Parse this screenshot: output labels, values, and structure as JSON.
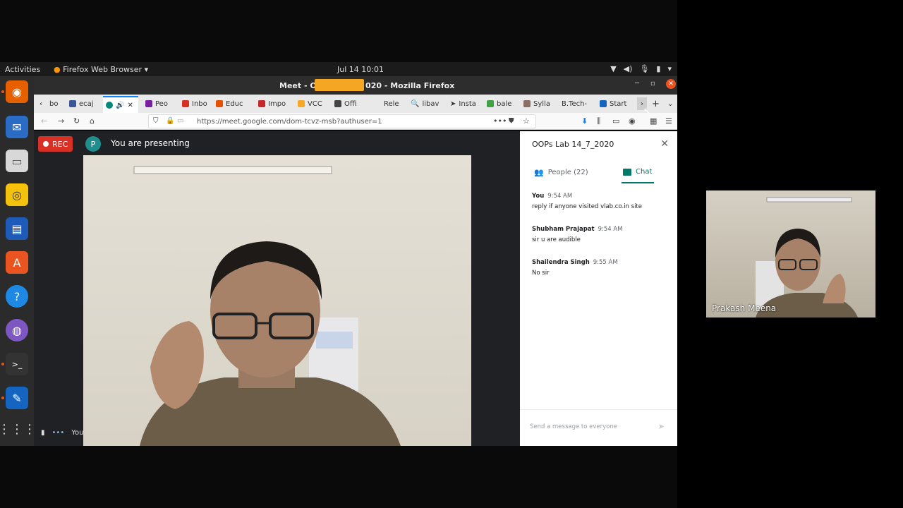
{
  "topbar": {
    "activities": "Activities",
    "app_menu": "Firefox Web Browser",
    "clock": "Jul 14  10:01"
  },
  "window": {
    "title": "Meet - OC                020 - Mozilla Firefox"
  },
  "tabs": [
    {
      "label": "bo",
      "color": "#999"
    },
    {
      "label": "ecaj",
      "color": "#3b5998"
    },
    {
      "label": "",
      "color": "#00897b"
    },
    {
      "label": "Peo",
      "color": "#7b1fa2"
    },
    {
      "label": "Inbo",
      "color": "#d93025"
    },
    {
      "label": "Educ",
      "color": "#e65100"
    },
    {
      "label": "Impo",
      "color": "#c62828"
    },
    {
      "label": "VCC",
      "color": "#f9a825"
    },
    {
      "label": "Offi",
      "color": "#444"
    },
    {
      "label": "Rele",
      "color": "#888"
    },
    {
      "label": "libav",
      "color": "#555"
    },
    {
      "label": "Insta",
      "color": "#333"
    },
    {
      "label": "bale",
      "color": "#43a047"
    },
    {
      "label": "Sylla",
      "color": "#8d6e63"
    },
    {
      "label": "B.Tech-",
      "color": "#777"
    },
    {
      "label": "Start",
      "color": "#1565c0"
    }
  ],
  "navbar": {
    "url": "https://meet.google.com/dom-tcvz-msb?authuser=1"
  },
  "meet": {
    "rec_label": "REC",
    "avatar_letter": "P",
    "presenting": "You are presenting",
    "bottom_label": "You"
  },
  "chat": {
    "meeting_title": "OOPs Lab 14_7_2020",
    "people_tab": "People (22)",
    "chat_tab": "Chat",
    "messages": [
      {
        "sender": "You",
        "time": "9:54 AM",
        "text": "reply if anyone visited vlab.co.in site"
      },
      {
        "sender": "Shubham Prajapat",
        "time": "9:54 AM",
        "text": "sir u are audible"
      },
      {
        "sender": "Shailendra Singh",
        "time": "9:55 AM",
        "text": "No sir"
      }
    ],
    "send_placeholder": "Send a message to everyone"
  },
  "pip": {
    "name": "Prakash Meena"
  }
}
